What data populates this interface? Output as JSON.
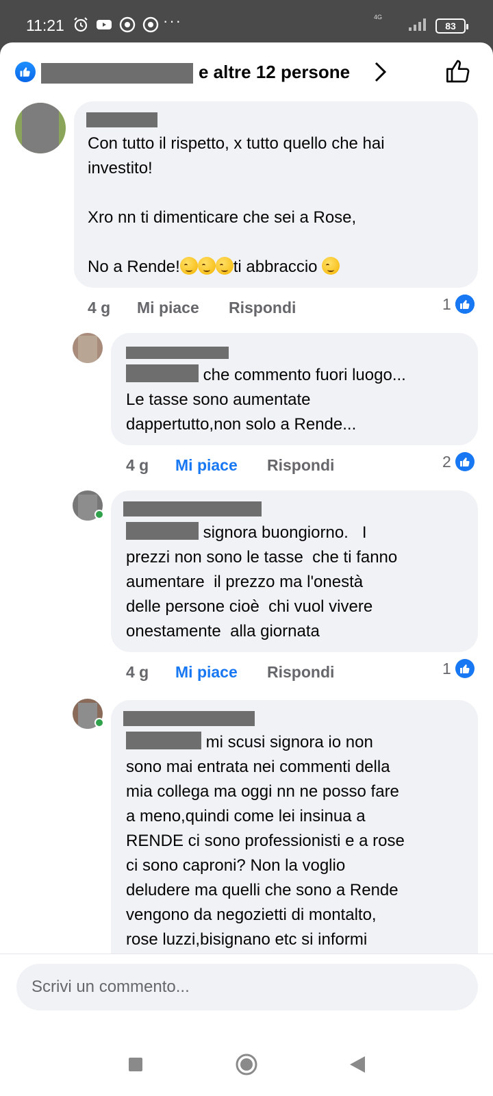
{
  "status_bar": {
    "time": "11:21",
    "network": "4G",
    "battery": "83"
  },
  "header": {
    "reactors_text": "e altre 12 persone"
  },
  "comments": [
    {
      "text": "Con tutto il rispetto, x tutto quello che hai\ninvestito!\n\nXro nn ti dimenticare che sei a Rose,\n\nNo a Rende!",
      "text_end": "ti abbraccio",
      "age": "4 g",
      "like_label": "Mi piace",
      "reply_label": "Rispondi",
      "likes": "1"
    },
    {
      "first_line": "che commento fuori luogo...",
      "text": "Le tasse sono aumentate\ndappertutto,non solo a Rende...",
      "age": "4 g",
      "like_label": "Mi piace",
      "reply_label": "Rispondi",
      "likes": "2"
    },
    {
      "first_line": "signora buongiorno.   I",
      "text": "prezzi non sono le tasse  che ti fanno\naumentare  il prezzo ma l'onestà\ndelle persone cioè  chi vuol vivere\nonestamente  alla giornata",
      "age": "4 g",
      "like_label": "Mi piace",
      "reply_label": "Rispondi",
      "likes": "1"
    },
    {
      "first_line": "mi scusi signora io non",
      "text": "sono mai entrata nei commenti della\nmia collega ma oggi nn ne posso fare\na meno,quindi come lei insinua a\nRENDE ci sono professionisti e a rose\nci sono caproni? Non la voglio\ndeludere ma quelli che sono a Rende\nvengono da negozietti di montalto,\nrose luzzi,bisignano etc si informi"
    }
  ],
  "composer": {
    "placeholder": "Scrivi un commento..."
  },
  "colors": {
    "accent": "#1877f2",
    "bubble": "#f0f2f5",
    "meta": "#65676b"
  }
}
